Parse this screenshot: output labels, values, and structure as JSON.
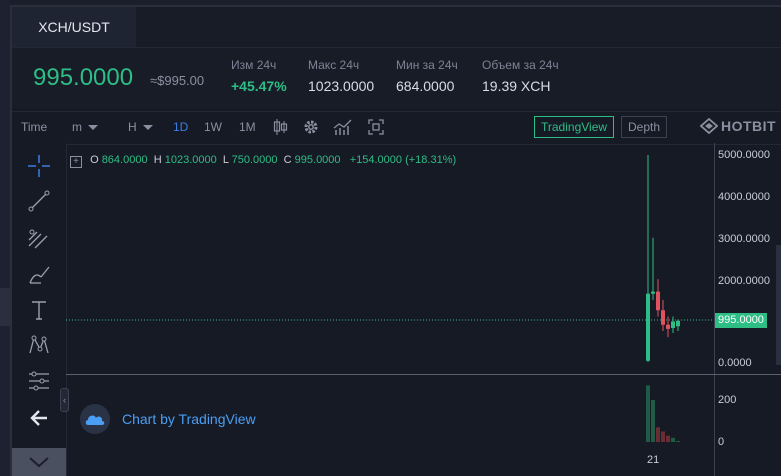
{
  "pair_tab": "XCH/USDT",
  "stats": {
    "price": "995.0000",
    "usd_equiv": "≈$995.00",
    "change": {
      "label": "Изм 24ч",
      "value": "+45.47%"
    },
    "high": {
      "label": "Макс 24ч",
      "value": "1023.0000"
    },
    "low": {
      "label": "Мин за 24ч",
      "value": "684.0000"
    },
    "volume": {
      "label": "Объем за 24ч",
      "value": "19.39 XCH"
    }
  },
  "toolbar": {
    "time": "Time",
    "minutes": "m",
    "hours": "H",
    "day": "1D",
    "week": "1W",
    "month": "1M",
    "tradingview": "TradingView",
    "depth": "Depth",
    "brand": "HOTBIT"
  },
  "ohlc": {
    "o_label": "O",
    "o": "864.0000",
    "h_label": "H",
    "h": "1023.0000",
    "l_label": "L",
    "l": "750.0000",
    "c_label": "C",
    "c": "995.0000",
    "change": "+154.0000 (+18.31%)"
  },
  "tv_badge": "Chart by TradingView",
  "axis": {
    "price_ticks": [
      "5000.0000",
      "4000.0000",
      "3000.0000",
      "2000.0000",
      "995.0000",
      "0.0000"
    ],
    "volume_ticks": [
      "200",
      "0"
    ],
    "current_price": "995.0000",
    "x_label": "21"
  },
  "colors": {
    "up": "#2ebd85",
    "down": "#e05260",
    "accent": "#3a7ee4"
  },
  "chart_data": {
    "type": "candlestick",
    "current_price": 995,
    "price_range": [
      0,
      5000
    ],
    "volume_range": [
      0,
      200
    ],
    "candles": [
      {
        "o": 30,
        "h": 5000,
        "l": 0,
        "c": 1650,
        "v": 300
      },
      {
        "o": 1650,
        "h": 3000,
        "l": 1500,
        "c": 1700,
        "v": 200
      },
      {
        "o": 1700,
        "h": 2000,
        "l": 1100,
        "c": 1250,
        "v": 70
      },
      {
        "o": 1250,
        "h": 1500,
        "l": 750,
        "c": 900,
        "v": 50
      },
      {
        "o": 900,
        "h": 1100,
        "l": 600,
        "c": 800,
        "v": 30
      },
      {
        "o": 820,
        "h": 1100,
        "l": 700,
        "c": 980,
        "v": 20
      },
      {
        "o": 864,
        "h": 1023,
        "l": 750,
        "c": 995,
        "v": 5
      }
    ]
  }
}
